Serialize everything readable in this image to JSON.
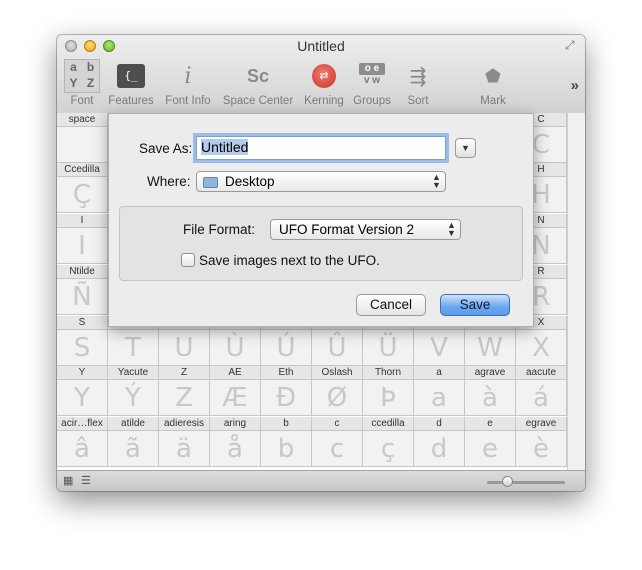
{
  "window": {
    "title": "Untitled"
  },
  "toolbar": {
    "items": [
      {
        "label": "Font",
        "icon": "font-glyphs-icon"
      },
      {
        "label": "Features",
        "icon": "features-icon"
      },
      {
        "label": "Font Info",
        "icon": "info-icon"
      },
      {
        "label": "Space Center",
        "icon": "space-center-icon"
      },
      {
        "label": "Kerning",
        "icon": "kerning-icon"
      },
      {
        "label": "Groups",
        "icon": "groups-icon"
      },
      {
        "label": "Sort",
        "icon": "sort-icon"
      },
      {
        "label": "Mark",
        "icon": "mark-icon"
      }
    ],
    "font_icon_letters": [
      "a",
      "b",
      "Y",
      "Z"
    ],
    "features_icon_text": "{_",
    "space_center_icon_text": "Sc",
    "groups_icon_text": [
      "o e",
      "v w"
    ],
    "overflow_icon": "»"
  },
  "glyph_grid": {
    "visible_rows": [
      [
        {
          "name": "space",
          "glyph": ""
        },
        {
          "name": "",
          "glyph": ""
        },
        {
          "name": "",
          "glyph": ""
        },
        {
          "name": "",
          "glyph": ""
        },
        {
          "name": "",
          "glyph": ""
        },
        {
          "name": "",
          "glyph": ""
        },
        {
          "name": "",
          "glyph": ""
        },
        {
          "name": "",
          "glyph": ""
        },
        {
          "name": "",
          "glyph": ""
        },
        {
          "name": "C",
          "glyph": "C"
        }
      ],
      [
        {
          "name": "Ccedilla",
          "glyph": "Ç"
        },
        {
          "name": "",
          "glyph": ""
        },
        {
          "name": "",
          "glyph": ""
        },
        {
          "name": "",
          "glyph": ""
        },
        {
          "name": "",
          "glyph": ""
        },
        {
          "name": "",
          "glyph": ""
        },
        {
          "name": "",
          "glyph": ""
        },
        {
          "name": "",
          "glyph": ""
        },
        {
          "name": "",
          "glyph": ""
        },
        {
          "name": "H",
          "glyph": "H"
        }
      ],
      [
        {
          "name": "I",
          "glyph": "I"
        },
        {
          "name": "",
          "glyph": ""
        },
        {
          "name": "",
          "glyph": ""
        },
        {
          "name": "",
          "glyph": ""
        },
        {
          "name": "",
          "glyph": ""
        },
        {
          "name": "",
          "glyph": ""
        },
        {
          "name": "",
          "glyph": ""
        },
        {
          "name": "",
          "glyph": ""
        },
        {
          "name": "",
          "glyph": ""
        },
        {
          "name": "N",
          "glyph": "N"
        }
      ],
      [
        {
          "name": "Ntilde",
          "glyph": "Ñ"
        },
        {
          "name": "",
          "glyph": ""
        },
        {
          "name": "",
          "glyph": ""
        },
        {
          "name": "",
          "glyph": ""
        },
        {
          "name": "",
          "glyph": ""
        },
        {
          "name": "",
          "glyph": ""
        },
        {
          "name": "",
          "glyph": ""
        },
        {
          "name": "",
          "glyph": ""
        },
        {
          "name": "",
          "glyph": ""
        },
        {
          "name": "R",
          "glyph": "R"
        }
      ],
      [
        {
          "name": "S",
          "glyph": "S"
        },
        {
          "name": "",
          "glyph": "T"
        },
        {
          "name": "",
          "glyph": "U"
        },
        {
          "name": "",
          "glyph": "Ù"
        },
        {
          "name": "",
          "glyph": "Ú"
        },
        {
          "name": "",
          "glyph": "Û"
        },
        {
          "name": "",
          "glyph": "Ü"
        },
        {
          "name": "",
          "glyph": "V"
        },
        {
          "name": "",
          "glyph": "W"
        },
        {
          "name": "X",
          "glyph": "X"
        }
      ],
      [
        {
          "name": "Y",
          "glyph": "Y"
        },
        {
          "name": "Yacute",
          "glyph": "Ý"
        },
        {
          "name": "Z",
          "glyph": "Z"
        },
        {
          "name": "AE",
          "glyph": "Æ"
        },
        {
          "name": "Eth",
          "glyph": "Ð"
        },
        {
          "name": "Oslash",
          "glyph": "Ø"
        },
        {
          "name": "Thorn",
          "glyph": "Þ"
        },
        {
          "name": "a",
          "glyph": "a"
        },
        {
          "name": "agrave",
          "glyph": "à"
        },
        {
          "name": "aacute",
          "glyph": "á"
        }
      ],
      [
        {
          "name": "acir…flex",
          "glyph": "â"
        },
        {
          "name": "atilde",
          "glyph": "ã"
        },
        {
          "name": "adieresis",
          "glyph": "ä"
        },
        {
          "name": "aring",
          "glyph": "å"
        },
        {
          "name": "b",
          "glyph": "b"
        },
        {
          "name": "c",
          "glyph": "c"
        },
        {
          "name": "ccedilla",
          "glyph": "ç"
        },
        {
          "name": "d",
          "glyph": "d"
        },
        {
          "name": "e",
          "glyph": "e"
        },
        {
          "name": "egrave",
          "glyph": "è"
        }
      ]
    ]
  },
  "save_sheet": {
    "save_as_label": "Save As:",
    "save_as_value": "Untitled",
    "where_label": "Where:",
    "where_value": "Desktop",
    "file_format_label": "File Format:",
    "file_format_value": "UFO Format Version 2",
    "save_images_label": "Save images next to the UFO.",
    "save_images_checked": false,
    "cancel_label": "Cancel",
    "save_label": "Save"
  },
  "bottom_bar": {
    "grid_view_icon": "grid-view-icon",
    "list_view_icon": "list-view-icon",
    "zoom_level": 0.25
  },
  "colors": {
    "accent_button": "#5b9ce9",
    "focus_ring": "#5d96e6",
    "kerning_icon": "#e2473d"
  }
}
